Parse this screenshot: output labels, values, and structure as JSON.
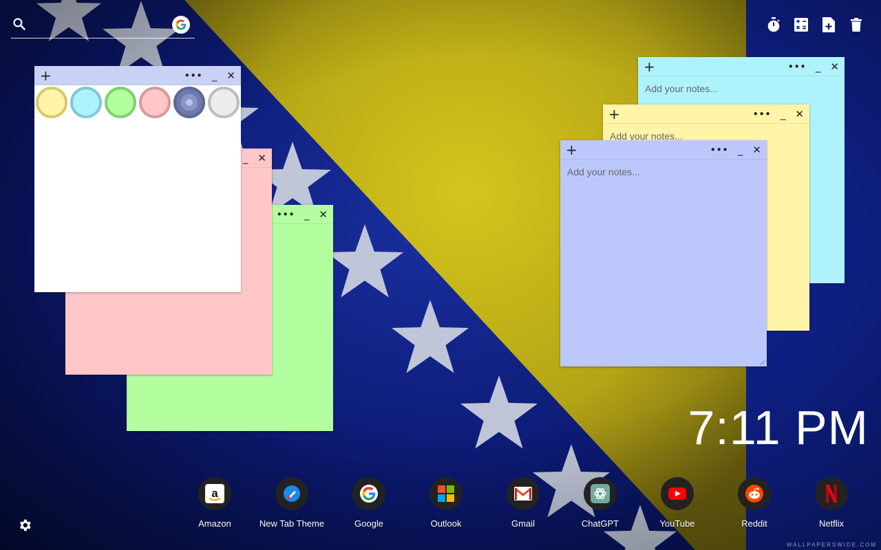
{
  "search": {
    "placeholder": "",
    "value": ""
  },
  "icons": {
    "search": "search-icon",
    "google": "google-icon",
    "timer": "timer-icon",
    "calculator": "calculator-icon",
    "new_note": "new-note-icon",
    "trash": "trash-icon",
    "settings": "gear-icon"
  },
  "notes": {
    "palette_note": {
      "plus": "+",
      "more": "•••",
      "minimize": "_",
      "close": "✕",
      "swatches": [
        {
          "fill": "#fff4a8",
          "ring": "#d8c96a"
        },
        {
          "fill": "#aef3fc",
          "ring": "#7fc9d2"
        },
        {
          "fill": "#b3ff9f",
          "ring": "#82cf71"
        },
        {
          "fill": "#ffc7c7",
          "ring": "#d59a9a"
        },
        {
          "fill": "#8a95c7",
          "ring": "#5d6899"
        },
        {
          "fill": "#ececec",
          "ring": "#bdbdbd"
        }
      ]
    },
    "pink_note": {
      "minimize": "_",
      "close": "✕"
    },
    "green_note": {
      "more": "•••",
      "minimize": "_",
      "close": "✕"
    },
    "cyan_note": {
      "plus": "+",
      "more": "•••",
      "minimize": "_",
      "close": "✕",
      "placeholder": "Add your notes..."
    },
    "yellow_note": {
      "plus": "+",
      "more": "•••",
      "minimize": "_",
      "close": "✕",
      "placeholder": "Add your notes..."
    },
    "blue_note": {
      "plus": "+",
      "more": "•••",
      "minimize": "_",
      "close": "✕",
      "placeholder": "Add your notes..."
    }
  },
  "clock": {
    "time": "7:11 PM"
  },
  "shortcuts": [
    {
      "label": "Amazon",
      "icon": "amazon-icon"
    },
    {
      "label": "New Tab Theme",
      "icon": "brush-icon"
    },
    {
      "label": "Google",
      "icon": "google-icon"
    },
    {
      "label": "Outlook",
      "icon": "windows-icon"
    },
    {
      "label": "Gmail",
      "icon": "gmail-icon"
    },
    {
      "label": "ChatGPT",
      "icon": "chatgpt-icon"
    },
    {
      "label": "YouTube",
      "icon": "youtube-icon"
    },
    {
      "label": "Reddit",
      "icon": "reddit-icon"
    },
    {
      "label": "Netflix",
      "icon": "netflix-icon"
    }
  ],
  "watermark": "WALLPAPERSWIDE.COM",
  "colors": {
    "flag_blue": "#13279a",
    "flag_yellow": "#c9b81a",
    "star_white": "#d8dde6"
  }
}
